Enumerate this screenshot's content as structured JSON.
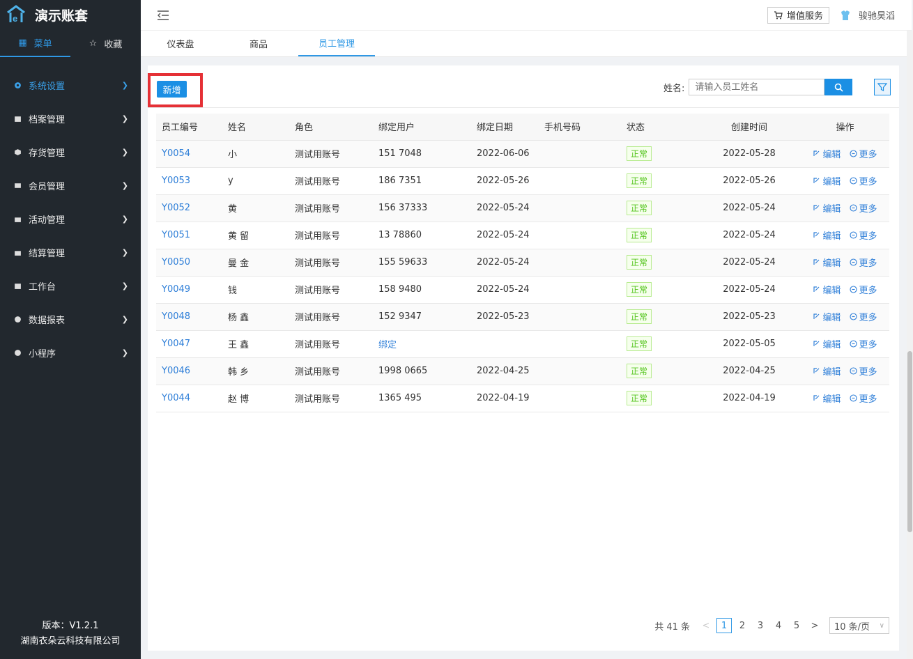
{
  "app": {
    "title": "演示账套",
    "version": "版本：V1.2.1",
    "company": "湖南衣朵云科技有限公司"
  },
  "sidebar": {
    "tabs": [
      {
        "label": "菜单"
      },
      {
        "label": "收藏"
      }
    ],
    "items": [
      {
        "label": "系统设置"
      },
      {
        "label": "档案管理"
      },
      {
        "label": "存货管理"
      },
      {
        "label": "会员管理"
      },
      {
        "label": "活动管理"
      },
      {
        "label": "结算管理"
      },
      {
        "label": "工作台"
      },
      {
        "label": "数据报表"
      },
      {
        "label": "小程序"
      }
    ]
  },
  "topbar": {
    "value_service": "增值服务",
    "user_name": "骏驰昊滔"
  },
  "tabs": [
    {
      "label": "仪表盘"
    },
    {
      "label": "商品"
    },
    {
      "label": "员工管理"
    }
  ],
  "toolbar": {
    "add_label": "新增",
    "search_label": "姓名:",
    "search_placeholder": "请输入员工姓名"
  },
  "table": {
    "headers": [
      "员工编号",
      "姓名",
      "角色",
      "绑定用户",
      "绑定日期",
      "手机号码",
      "状态",
      "创建时间",
      "操作"
    ],
    "rows": [
      {
        "code": "Y0054",
        "name": "小",
        "role": "测试用账号",
        "user": "151   7048",
        "bind_date": "2022-06-06",
        "phone": "",
        "status": "正常",
        "created": "2022-05-28"
      },
      {
        "code": "Y0053",
        "name": "y",
        "role": "测试用账号",
        "user": "186   7351",
        "bind_date": "2022-05-26",
        "phone": "",
        "status": "正常",
        "created": "2022-05-26"
      },
      {
        "code": "Y0052",
        "name": "黄",
        "role": "测试用账号",
        "user": "156   37333",
        "bind_date": "2022-05-24",
        "phone": "",
        "status": "正常",
        "created": "2022-05-24"
      },
      {
        "code": "Y0051",
        "name": "黄 留",
        "role": "测试用账号",
        "user": "13   78860",
        "bind_date": "2022-05-24",
        "phone": "",
        "status": "正常",
        "created": "2022-05-24"
      },
      {
        "code": "Y0050",
        "name": "曼 金",
        "role": "测试用账号",
        "user": "155   59633",
        "bind_date": "2022-05-24",
        "phone": "",
        "status": "正常",
        "created": "2022-05-24"
      },
      {
        "code": "Y0049",
        "name": "钱",
        "role": "测试用账号",
        "user": "158   9480",
        "bind_date": "2022-05-24",
        "phone": "",
        "status": "正常",
        "created": "2022-05-24"
      },
      {
        "code": "Y0048",
        "name": "杨 鑫",
        "role": "测试用账号",
        "user": "152   9347",
        "bind_date": "2022-05-23",
        "phone": "",
        "status": "正常",
        "created": "2022-05-23"
      },
      {
        "code": "Y0047",
        "name": "王 鑫",
        "role": "测试用账号",
        "user": "绑定",
        "bind_date": "",
        "phone": "",
        "status": "正常",
        "created": "2022-05-05"
      },
      {
        "code": "Y0046",
        "name": "韩 乡",
        "role": "测试用账号",
        "user": "1998   0665",
        "bind_date": "2022-04-25",
        "phone": "",
        "status": "正常",
        "created": "2022-04-25"
      },
      {
        "code": "Y0044",
        "name": "赵 博",
        "role": "测试用账号",
        "user": "1365   495",
        "bind_date": "2022-04-19",
        "phone": "",
        "status": "正常",
        "created": "2022-04-19"
      }
    ],
    "edit_label": "编辑",
    "more_label": "更多"
  },
  "pager": {
    "total": "共 41 条",
    "pages": [
      "1",
      "2",
      "3",
      "4",
      "5"
    ],
    "per_page": "10 条/页"
  },
  "colors": {
    "accent": "#1b8fe4",
    "sidebar_bg": "#22282e",
    "highlight": "#e53035",
    "status_ok": "#52c41a"
  }
}
